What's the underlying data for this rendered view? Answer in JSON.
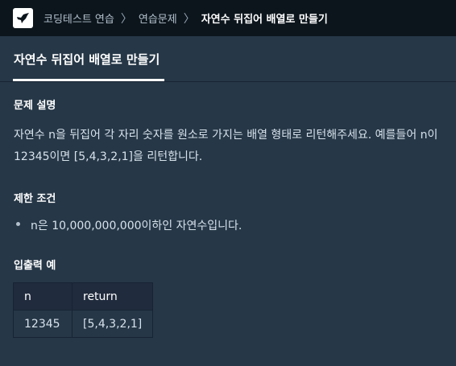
{
  "breadcrumb": {
    "items": [
      "코딩테스트 연습",
      "연습문제",
      "자연수 뒤집어 배열로 만들기"
    ],
    "separator": "〉"
  },
  "tab": {
    "title": "자연수 뒤집어 배열로 만들기"
  },
  "description": {
    "heading": "문제 설명",
    "text": "자연수 n을 뒤집어 각 자리 숫자를 원소로 가지는 배열 형태로 리턴해주세요. 예를들어 n이 12345이면 [5,4,3,2,1]을 리턴합니다."
  },
  "limits": {
    "heading": "제한 조건",
    "items": [
      "n은 10,000,000,000이하인 자연수입니다."
    ]
  },
  "io": {
    "heading": "입출력 예",
    "columns": [
      "n",
      "return"
    ],
    "rows": [
      [
        "12345",
        "[5,4,3,2,1]"
      ]
    ]
  },
  "icons": {
    "logo": "programmers-bird-logo-icon"
  },
  "colors": {
    "background": "#263747",
    "topbar": "#0c151c",
    "table_header": "#202b3d"
  }
}
